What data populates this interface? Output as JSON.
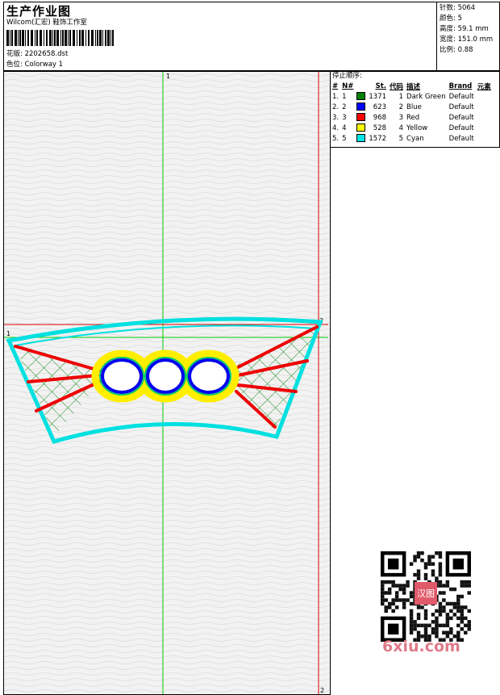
{
  "header": {
    "title": "生产作业图",
    "company": "Wilcom(汇宏) 鞋饰工作室",
    "design_label": "花版:",
    "design_value": "2202658.dst",
    "colorway_label": "色位:",
    "colorway_value": "Colorway 1"
  },
  "stats": [
    {
      "label": "针数:",
      "value": "5064"
    },
    {
      "label": "颜色:",
      "value": "5"
    },
    {
      "label": "高度:",
      "value": "59.1 mm"
    },
    {
      "label": "宽度:",
      "value": "151.0 mm"
    },
    {
      "label": "比例:",
      "value": "0.88"
    }
  ],
  "stop_sequence": {
    "title": "停止顺序:",
    "columns": [
      "#",
      "N#",
      "St.",
      "代码",
      "描述",
      "Brand",
      "元素"
    ],
    "rows": [
      {
        "idx": "1.",
        "n": "1",
        "color": "#008000",
        "st": "1371",
        "code": "1",
        "desc": "Dark Green",
        "brand": "Default"
      },
      {
        "idx": "2.",
        "n": "2",
        "color": "#0000ff",
        "st": "623",
        "code": "2",
        "desc": "Blue",
        "brand": "Default"
      },
      {
        "idx": "3.",
        "n": "3",
        "color": "#ff0000",
        "st": "968",
        "code": "3",
        "desc": "Red",
        "brand": "Default"
      },
      {
        "idx": "4.",
        "n": "4",
        "color": "#ffff00",
        "st": "528",
        "code": "4",
        "desc": "Yellow",
        "brand": "Default"
      },
      {
        "idx": "5.",
        "n": "5",
        "color": "#00e5e5",
        "st": "1572",
        "code": "5",
        "desc": "Cyan",
        "brand": "Default"
      }
    ]
  },
  "guides": {
    "green_v_label": "1",
    "green_h_label": "1",
    "red_h_label": "2",
    "red_v_label": "2"
  },
  "watermark": "6xiu.com",
  "qr_center_text": "汉图"
}
